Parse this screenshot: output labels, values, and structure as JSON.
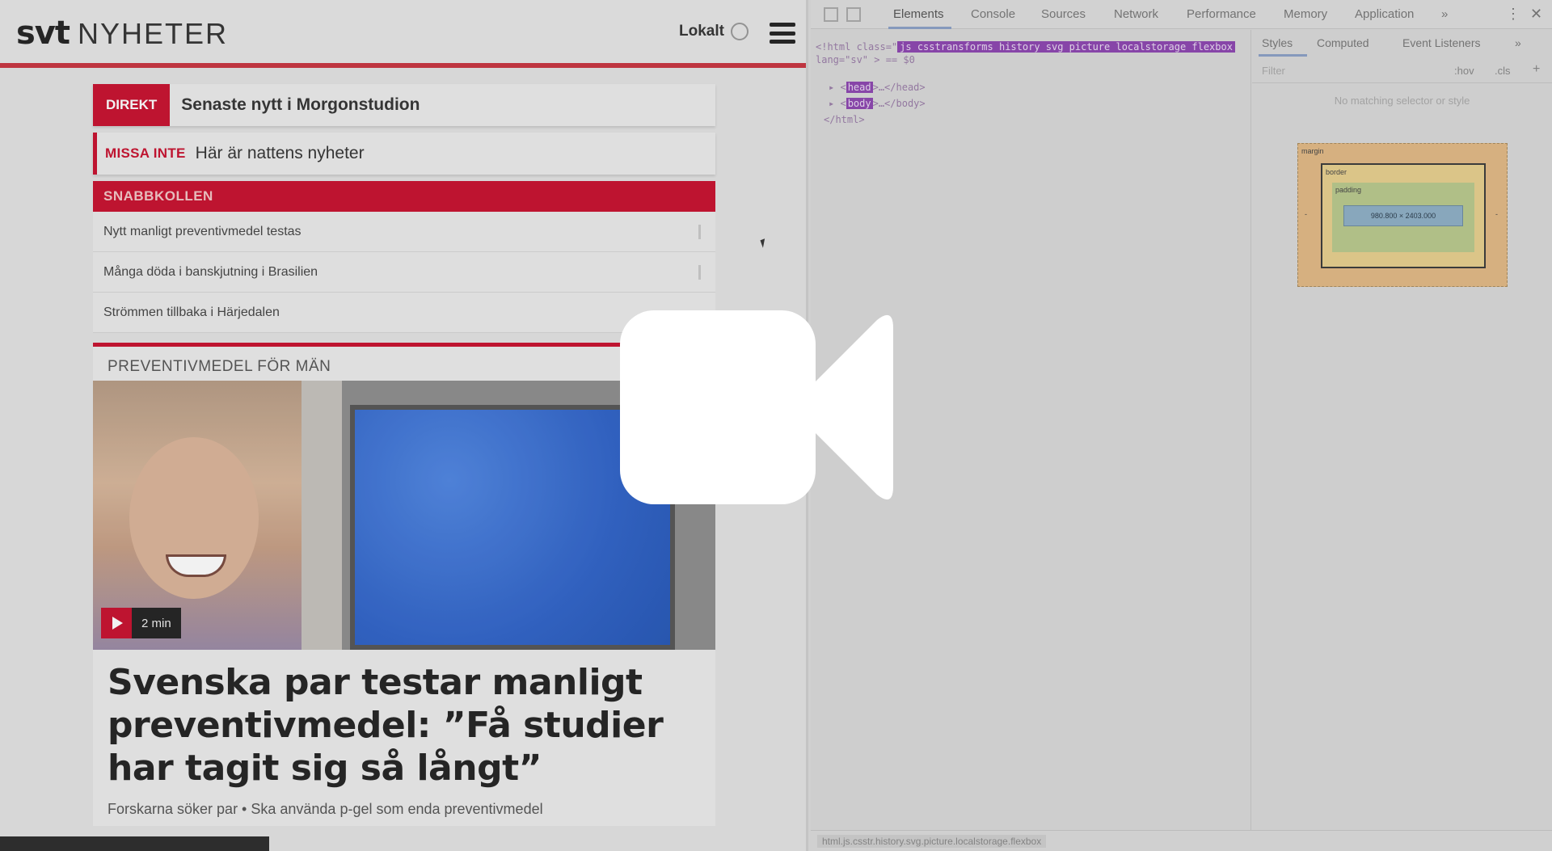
{
  "site": {
    "logo_svt": "svt",
    "logo_nyheter": "NYHETER",
    "lokalt_label": "Lokalt",
    "direkt_badge": "DIREKT",
    "direkt_text": "Senaste nytt i Morgonstudion",
    "missa_label": "MISSA INTE",
    "missa_text": "Här är nattens nyheter",
    "snabbkollen_title": "SNABBKOLLEN",
    "snabbkollen_items": [
      "Nytt manligt preventivmedel testas",
      "Många döda i banskjutning i Brasilien",
      "Strömmen tillbaka i Härjedalen"
    ],
    "article": {
      "kicker": "PREVENTIVMEDEL FÖR MÄN",
      "video_duration": "2 min",
      "headline": "Svenska par testar manligt preventivmedel: ”Få studier har tagit sig så långt”",
      "subline": "Forskarna söker par • Ska använda p-gel som enda preventivmedel"
    }
  },
  "devtools": {
    "tabs": [
      "Elements",
      "Console",
      "Sources",
      "Network",
      "Performance",
      "Memory",
      "Application",
      "»"
    ],
    "active_tab": "Elements",
    "dom": {
      "line1_prefix": "<!html class=\"",
      "line1_classes": "js csstransforms history svg picture localstorage flexbox",
      "line2": "lang=\"sv\" > == $0",
      "head": "head",
      "head_rest": ">…</head>",
      "body": "body",
      "body_rest": ">…</body>",
      "close": "</html>"
    },
    "styles_tabs": [
      "Styles",
      "Computed",
      "Event Listeners",
      "»"
    ],
    "filter_placeholder": "Filter",
    "hov": ":hov",
    "cls": ".cls",
    "plus": "+",
    "no_style_msg": "No matching selector or style",
    "box": {
      "margin_label": "margin",
      "border_label": "border",
      "padding_label": "padding",
      "content": "980.800 × 2403.000",
      "side_value": "-"
    },
    "status_path": "html.js.csstr.history.svg.picture.localstorage.flexbox"
  },
  "colors": {
    "svt_red": "#c8102e",
    "dom_highlight": "#8d45b0",
    "margin_box": "#e2b985",
    "border_box": "#e8d08e",
    "padding_box": "#b9c98d",
    "content_box": "#8eafc6"
  },
  "overlay": {
    "icon": "video-camera-icon"
  }
}
